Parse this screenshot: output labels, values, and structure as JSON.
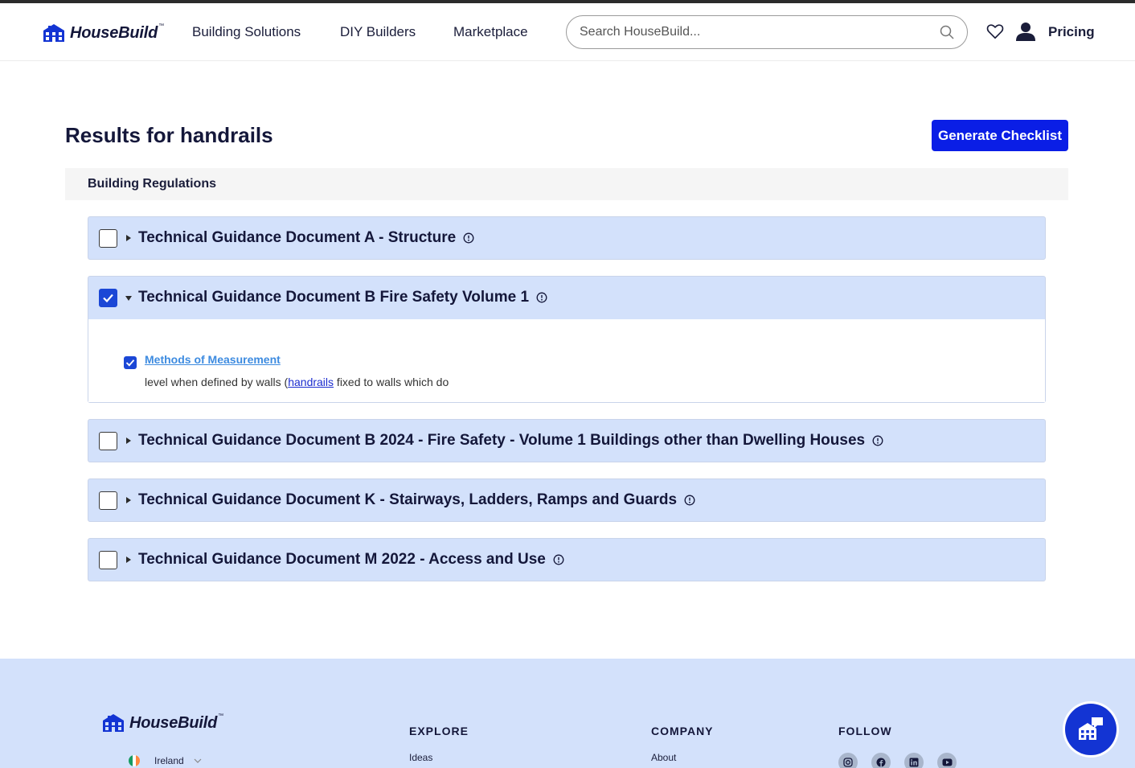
{
  "header": {
    "logo_text": "HouseBuild",
    "logo_tm": "™",
    "nav": [
      "Building Solutions",
      "DIY Builders",
      "Marketplace"
    ],
    "search_placeholder": "Search HouseBuild...",
    "pricing": "Pricing"
  },
  "main": {
    "title": "Results for handrails",
    "generate_button": "Generate Checklist",
    "section_label": "Building Regulations",
    "documents": [
      {
        "title": "Technical Guidance Document A - Structure",
        "checked": false,
        "expanded": false
      },
      {
        "title": "Technical Guidance Document B Fire Safety Volume 1",
        "checked": true,
        "expanded": true
      },
      {
        "title": "Technical Guidance Document B 2024 - Fire Safety - Volume 1 Buildings other than Dwelling Houses",
        "checked": false,
        "expanded": false
      },
      {
        "title": "Technical Guidance Document K - Stairways, Ladders, Ramps and Guards",
        "checked": false,
        "expanded": false
      },
      {
        "title": "Technical Guidance Document M 2022 - Access and Use",
        "checked": false,
        "expanded": false
      }
    ],
    "expanded_result": {
      "link": "Methods of Measurement",
      "snippet_before": "level when defined by walls (",
      "snippet_highlight": "handrails",
      "snippet_after": " fixed to walls which do"
    }
  },
  "footer": {
    "logo_text": "HouseBuild",
    "logo_tm": "™",
    "country": "Ireland",
    "explore_heading": "EXPLORE",
    "explore_link": "Ideas",
    "company_heading": "COMPANY",
    "company_link": "About",
    "follow_heading": "FOLLOW",
    "social_icons": [
      "instagram-icon",
      "facebook-icon",
      "linkedin-icon",
      "youtube-icon"
    ]
  },
  "colors": {
    "accent": "#0a1ee6",
    "accordion_bg": "#d3e1fb",
    "checkbox_checked": "#1b47d6",
    "link": "#3d8be0"
  }
}
